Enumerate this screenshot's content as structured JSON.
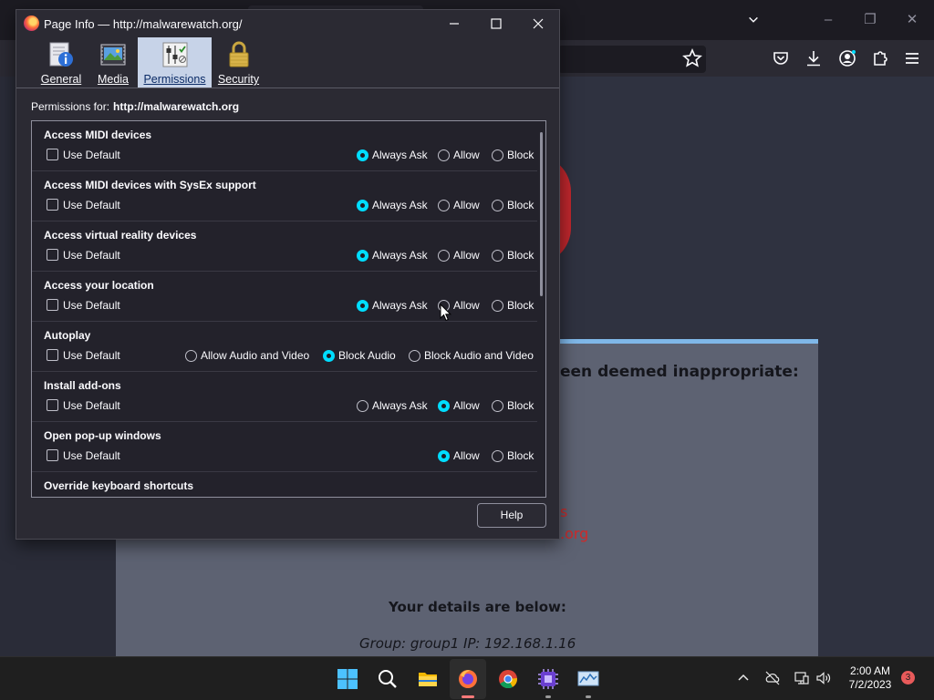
{
  "background": {
    "heading_fragment": "een deemed inappropriate:",
    "red_line1": "s",
    "red_line2": ".org",
    "details_heading": "Your details are below:",
    "group_line": "Group: group1   IP: 192.168.1.16"
  },
  "dialog": {
    "title": "Page Info — http://malwarewatch.org/",
    "tabs": [
      {
        "label": "General",
        "icon": "info-icon"
      },
      {
        "label": "Media",
        "icon": "media-icon"
      },
      {
        "label": "Permissions",
        "icon": "permissions-icon",
        "active": true
      },
      {
        "label": "Security",
        "icon": "lock-icon"
      }
    ],
    "permissions_for_label": "Permissions for:",
    "permissions_for_url": "http://malwarewatch.org",
    "use_default_label": "Use Default",
    "permissions": [
      {
        "title": "Access MIDI devices",
        "options": [
          "Always Ask",
          "Allow",
          "Block"
        ],
        "selected": "Always Ask"
      },
      {
        "title": "Access MIDI devices with SysEx support",
        "options": [
          "Always Ask",
          "Allow",
          "Block"
        ],
        "selected": "Always Ask"
      },
      {
        "title": "Access virtual reality devices",
        "options": [
          "Always Ask",
          "Allow",
          "Block"
        ],
        "selected": "Always Ask"
      },
      {
        "title": "Access your location",
        "options": [
          "Always Ask",
          "Allow",
          "Block"
        ],
        "selected": "Always Ask"
      },
      {
        "title": "Autoplay",
        "options": [
          "Allow Audio and Video",
          "Block Audio",
          "Block Audio and Video"
        ],
        "selected": "Block Audio"
      },
      {
        "title": "Install add-ons",
        "options": [
          "Always Ask",
          "Allow",
          "Block"
        ],
        "selected": "Allow"
      },
      {
        "title": "Open pop-up windows",
        "options": [
          "Allow",
          "Block"
        ],
        "selected": "Allow"
      },
      {
        "title": "Override keyboard shortcuts",
        "options": [],
        "selected": ""
      }
    ],
    "help_label": "Help"
  },
  "taskbar": {
    "apps": [
      "start-icon",
      "search-icon",
      "file-explorer-icon",
      "firefox-icon",
      "chrome-icon",
      "cpu-app-icon",
      "monitor-app-icon"
    ],
    "time": "2:00 AM",
    "date": "7/2/2023",
    "notification_count": "3"
  },
  "colors": {
    "accent": "#00ddff",
    "dialog_bg": "#2b2a33",
    "active_tab": "#c7d3e8",
    "taskbar_bg": "#1f1f1f"
  }
}
